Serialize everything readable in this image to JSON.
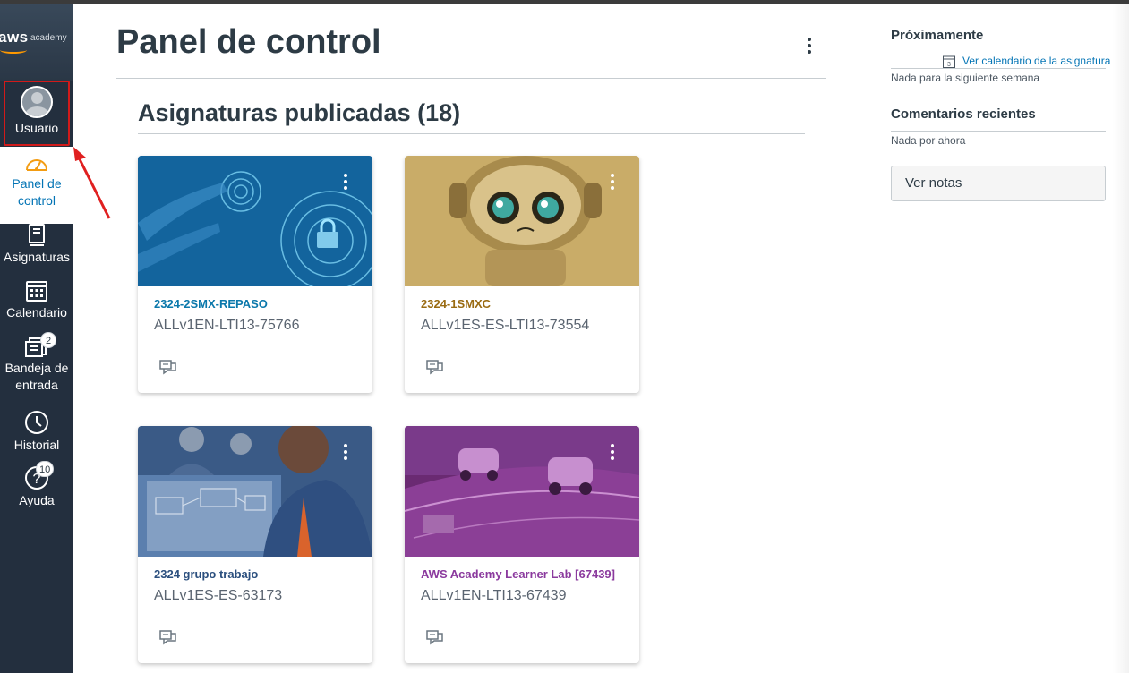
{
  "brand": {
    "logo_text": "aws",
    "logo_sub": "academy"
  },
  "nav": {
    "user": "Usuario",
    "dashboard": "Panel de control",
    "dashboard_line1": "Panel de",
    "dashboard_line2": "control",
    "courses": "Asignaturas",
    "calendar": "Calendario",
    "inbox_line1": "Bandeja de",
    "inbox_line2": "entrada",
    "inbox_badge": "2",
    "history": "Historial",
    "help": "Ayuda",
    "help_badge": "10"
  },
  "main": {
    "title": "Panel de control",
    "section_title": "Asignaturas publicadas (18)",
    "cards": [
      {
        "title": "2324-2SMX-REPASO",
        "subtitle": "ALLv1EN-LTI13-75766",
        "color": "#0b78ab"
      },
      {
        "title": "2324-1SMXC",
        "subtitle": "ALLv1ES-ES-LTI13-73554",
        "color": "#9a6b12"
      },
      {
        "title": "2324 grupo trabajo",
        "subtitle": "ALLv1ES-ES-63173",
        "color": "#2b4f7e"
      },
      {
        "title": "AWS Academy Learner Lab [67439]",
        "subtitle": "ALLv1EN-LTI13-67439",
        "color": "#8b3a9e"
      }
    ]
  },
  "sidebar": {
    "upcoming_title": "Próximamente",
    "calendar_link": "Ver calendario de la asignatura",
    "calendar_icon_day": "3",
    "upcoming_empty": "Nada para la siguiente semana",
    "feedback_title": "Comentarios recientes",
    "feedback_empty": "Nada por ahora",
    "notes_button": "Ver notas"
  },
  "colors": {
    "nav_bg": "#232f3e",
    "accent": "#0374b5",
    "highlight": "#d11a1a",
    "arrow": "#e02020"
  }
}
